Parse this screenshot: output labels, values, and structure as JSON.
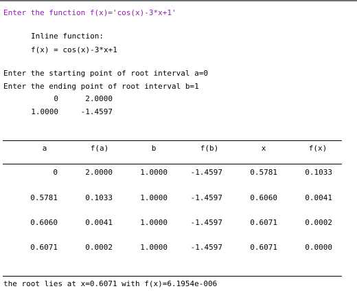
{
  "colors": {
    "prompt_purple": "#8b22b0",
    "rule": "#000000",
    "top_border": "#707070"
  },
  "console": {
    "line_prompt": "Enter the function f(x)='cos(x)-3*x+1'",
    "inline_label": "Inline function:",
    "inline_expr": "f(x) = cos(x)-3*x+1",
    "line_a": "Enter the starting point of root interval a=0",
    "line_b": "Enter the ending point of root interval b=1",
    "matrix": [
      [
        "0",
        "2.0000"
      ],
      [
        "1.0000",
        "-1.4597"
      ]
    ],
    "result": "the root lies at x=0.6071 with f(x)=6.1954e-006"
  },
  "table": {
    "headers": [
      "a",
      "f(a)",
      "b",
      "f(b)",
      "x",
      "f(x)"
    ],
    "rows": [
      [
        "0",
        "2.0000",
        "1.0000",
        "-1.4597",
        "0.5781",
        "0.1033"
      ],
      [
        "0.5781",
        "0.1033",
        "1.0000",
        "-1.4597",
        "0.6060",
        "0.0041"
      ],
      [
        "0.6060",
        "0.0041",
        "1.0000",
        "-1.4597",
        "0.6071",
        "0.0002"
      ],
      [
        "0.6071",
        "0.0002",
        "1.0000",
        "-1.4597",
        "0.6071",
        "0.0000"
      ]
    ]
  }
}
